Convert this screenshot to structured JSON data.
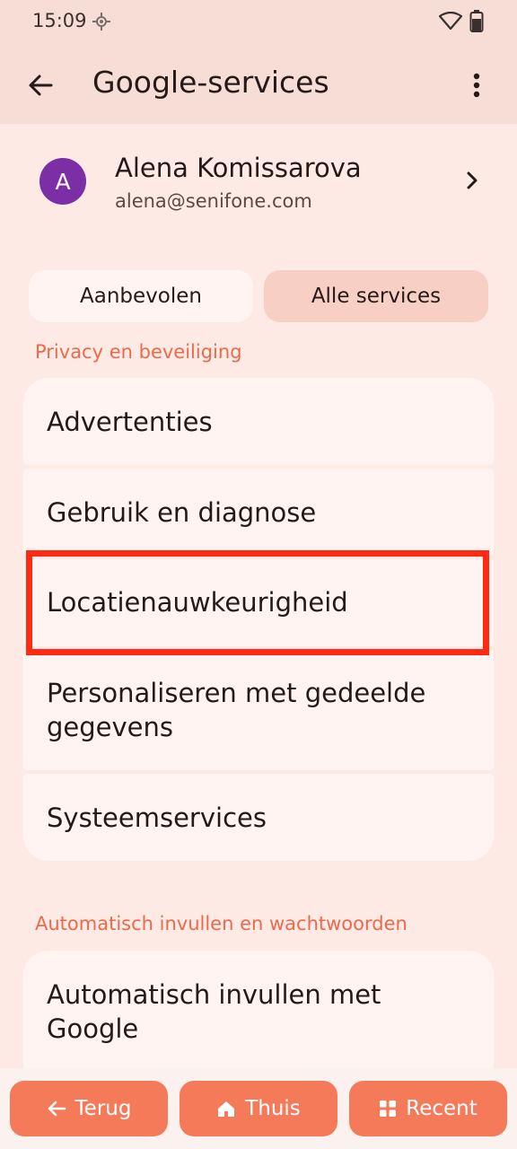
{
  "status": {
    "time": "15:09"
  },
  "appbar": {
    "title": "Google-services"
  },
  "account": {
    "initial": "A",
    "name": "Alena Komissarova",
    "email": "alena@senifone.com"
  },
  "tabs": [
    {
      "label": "Aanbevolen"
    },
    {
      "label": "Alle services"
    }
  ],
  "sections": [
    {
      "header": "Privacy en beveiliging",
      "items": [
        {
          "label": "Advertenties"
        },
        {
          "label": "Gebruik en diagnose"
        },
        {
          "label": "Locatienauwkeurigheid"
        },
        {
          "label": "Personaliseren met gedeelde gegevens"
        },
        {
          "label": "Systeemservices"
        }
      ]
    },
    {
      "header": "Automatisch invullen en wachtwoorden",
      "items": [
        {
          "label": "Automatisch invullen met Google"
        }
      ]
    }
  ],
  "nav": {
    "back": "Terug",
    "home": "Thuis",
    "recent": "Recent"
  },
  "colors": {
    "accent": "#f47a5a",
    "section_header": "#eb6a4c",
    "highlight": "#ff2a12",
    "avatar": "#7b2ea6"
  }
}
